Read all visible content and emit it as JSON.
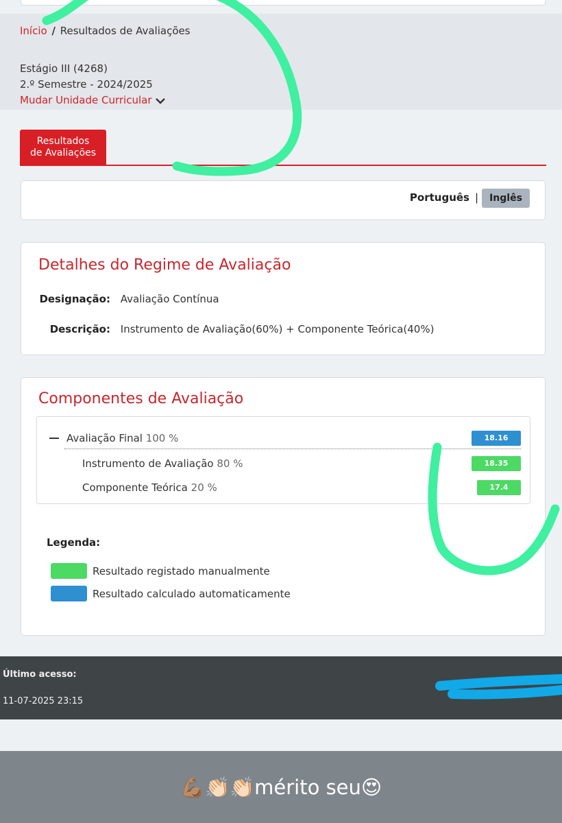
{
  "breadcrumb": {
    "home": "Início",
    "separator": "/",
    "current": "Resultados de Avaliações"
  },
  "unit": {
    "name": "Estágio III (4268)",
    "semester": "2.º Semestre - 2024/2025",
    "change_link": "Mudar Unidade Curricular",
    "change_icon": "chevron-down-icon"
  },
  "tabs": {
    "active_line1": "Resultados",
    "active_line2": "de Avaliações"
  },
  "language": {
    "portuguese": "Português",
    "separator": "|",
    "english": "Inglês"
  },
  "regime": {
    "title": "Detalhes do Regime de Avaliação",
    "designation_label": "Designação:",
    "designation_value": "Avaliação Contínua",
    "description_label": "Descrição:",
    "description_value": "Instrumento de Avaliação(60%) + Componente Teórica(40%)"
  },
  "components": {
    "title": "Componentes de Avaliação",
    "rows": [
      {
        "name": "Avaliação Final",
        "weight": "100 %",
        "grade": "18.16",
        "type": "auto"
      },
      {
        "name": "Instrumento de Avaliação",
        "weight": "80 %",
        "grade": "18.35",
        "type": "manual"
      },
      {
        "name": "Componente Teórica",
        "weight": "20 %",
        "grade": "17.4",
        "type": "manual"
      }
    ]
  },
  "legend": {
    "title": "Legenda:",
    "manual": "Resultado registado manualmente",
    "auto": "Resultado calculado automaticamente"
  },
  "footer": {
    "last_access_label": "Último acesso:",
    "last_access_value": "11-07-2025 23:15"
  },
  "story": {
    "caption": "💪🏽👏🏻👏🏻mérito seu😍"
  },
  "colors": {
    "brand_red": "#d81f26",
    "auto_blue": "#2e8fd1",
    "manual_green": "#4cd964",
    "scribble_green": "#3ef0a0",
    "scribble_blue": "#12a9e8"
  }
}
